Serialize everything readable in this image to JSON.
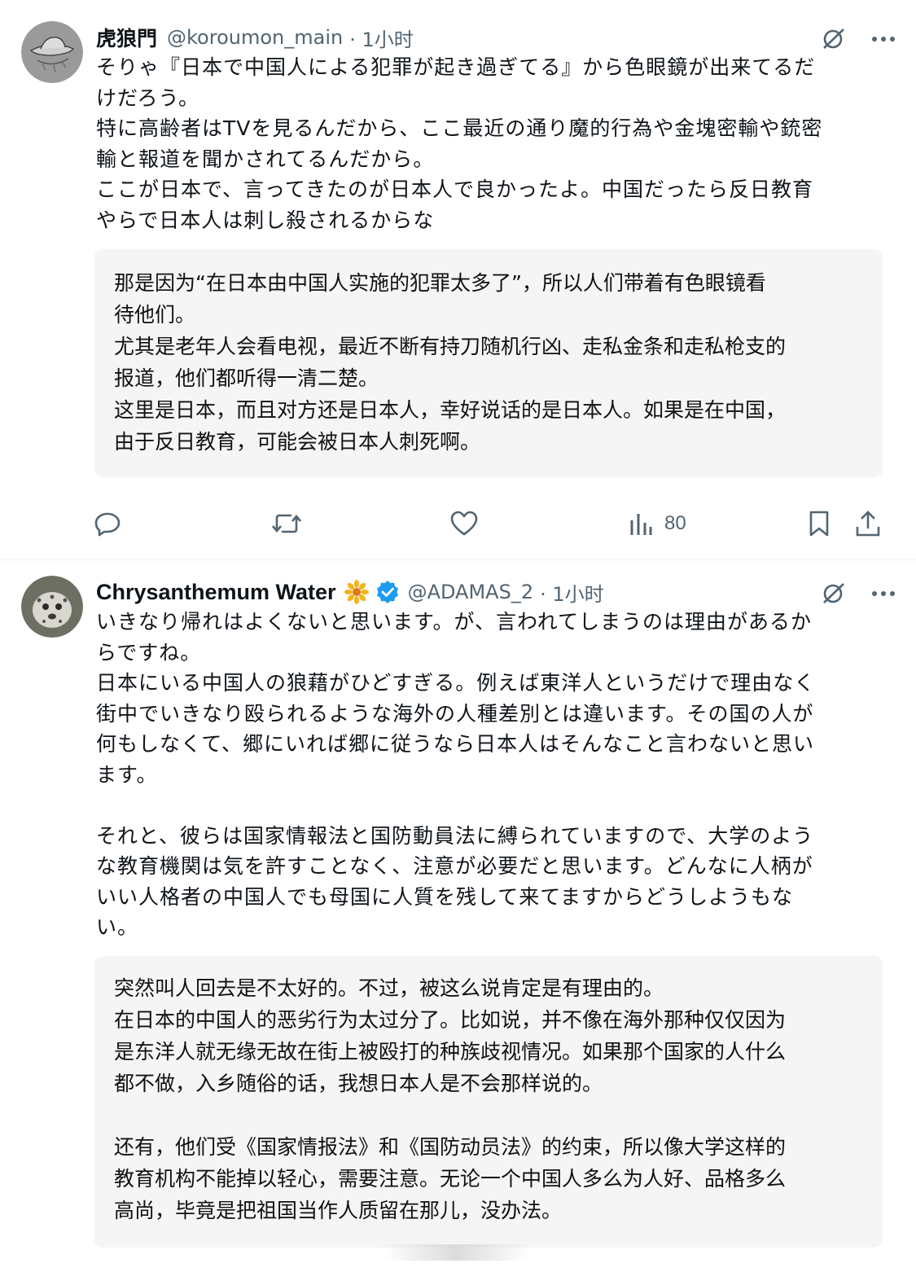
{
  "posts": [
    {
      "author": {
        "name": "虎狼門",
        "handle": "@koroumon_main",
        "time": "· 1小时",
        "avatar_icon": "hat-sketch-avatar"
      },
      "text": "そりゃ『日本で中国人による犯罪が起き過ぎてる』から色眼鏡が出来てるだ\nけだろう。\n特に高齢者はTVを見るんだから、ここ最近の通り魔的行為や金塊密輸や銃密\n輸と報道を聞かされてるんだから。\nここが日本で、言ってきたのが日本人で良かったよ。中国だったら反日教育\nやらで日本人は刺し殺されるからな",
      "translation": "那是因为“在日本由中国人实施的犯罪太多了”，所以人们带着有色眼镜看\n待他们。\n尤其是老年人会看电视，最近不断有持刀随机行凶、走私金条和走私枪支的\n报道，他们都听得一清二楚。\n这里是日本，而且对方还是日本人，幸好说话的是日本人。如果是在中国，\n由于反日教育，可能会被日本人刺死啊。",
      "actions": {
        "views": "80"
      }
    },
    {
      "author": {
        "name": "Chrysanthemum Water",
        "handle": "@ADAMAS_2",
        "time": "· 1小时",
        "avatar_icon": "snow-leopard-avatar",
        "badge_icon": "daisy-emoji-icon"
      },
      "text": "いきなり帰れはよくないと思います。が、言われてしまうのは理由があるか\nらですね。\n日本にいる中国人の狼藉がひどすぎる。例えば東洋人というだけで理由なく\n街中でいきなり殴られるような海外の人種差別とは違います。その国の人が\n何もしなくて、郷にいれば郷に従うなら日本人はそんなこと言わないと思い\nます。\n\nそれと、彼らは国家情報法と国防動員法に縛られていますので、大学のよう\nな教育機関は気を許すことなく、注意が必要だと思います。どんなに人柄が\nいい人格者の中国人でも母国に人質を残して来てますからどうしようもな\nい。",
      "translation": "突然叫人回去是不太好的。不过，被这么说肯定是有理由的。\n在日本的中国人的恶劣行为太过分了。比如说，并不像在海外那种仅仅因为\n是东洋人就无缘无故在街上被殴打的种族歧视情况。如果那个国家的人什么\n都不做，入乡随俗的话，我想日本人是不会那样说的。\n\n还有，他们受《国家情报法》和《国防动员法》的约束，所以像大学这样的\n教育机构不能掉以轻心，需要注意。无论一个中国人多么为人好、品格多么\n高尚，毕竟是把祖国当作人质留在那儿，没办法。"
    }
  ],
  "colors": {
    "text": "#0f1419",
    "secondary": "#536471",
    "translation_bg": "#f5f5f5",
    "verified": "#1d9bf0"
  }
}
